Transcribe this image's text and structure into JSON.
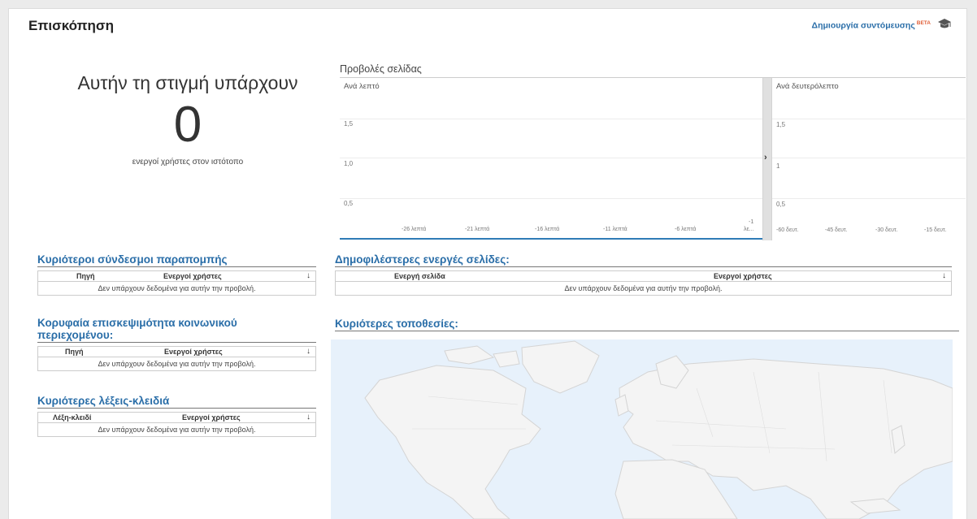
{
  "header": {
    "title": "Επισκόπηση",
    "shortcut_label": "Δημιουργία συντόμευσης",
    "beta_label": "BETA",
    "cap_icon": "graduation-cap-icon"
  },
  "active_users": {
    "headline": "Αυτήν τη στιγμή υπάρχουν",
    "count": "0",
    "subtitle": "ενεργοί χρήστες στον ιστότοπο"
  },
  "pageviews": {
    "title": "Προβολές σελίδας",
    "per_minute": {
      "label": "Ανά λεπτό",
      "y_ticks": [
        "1,5",
        "1,0",
        "0,5"
      ],
      "x_ticks": [
        "-26 λεπτά",
        "-21 λεπτά",
        "-16 λεπτά",
        "-11 λεπτά",
        "-6 λεπτά"
      ],
      "x_last_top": "-1",
      "x_last_bottom": "λε..."
    },
    "per_second": {
      "label": "Ανά δευτερόλεπτο",
      "y_ticks": [
        "1,5",
        "1",
        "0,5"
      ],
      "x_ticks": [
        "-60 δευτ.",
        "-45 δευτ.",
        "-30 δευτ.",
        "-15 δευτ."
      ]
    },
    "divider_arrow": "›"
  },
  "referrals": {
    "title": "Κυριότεροι σύνδεσμοι παραπομπής",
    "col1": "Πηγή",
    "col2": "Ενεργοί χρήστες",
    "empty": "Δεν υπάρχουν δεδομένα για αυτήν την προβολή."
  },
  "social": {
    "title_line1": "Κορυφαία επισκεψιμότητα κοινωνικού",
    "title_line2": "περιεχομένου:",
    "col1": "Πηγή",
    "col2": "Ενεργοί χρήστες",
    "empty": "Δεν υπάρχουν δεδομένα για αυτήν την προβολή."
  },
  "keywords": {
    "title": "Κυριότερες λέξεις-κλειδιά",
    "col1": "Λέξη-κλειδί",
    "col2": "Ενεργοί χρήστες",
    "empty": "Δεν υπάρχουν δεδομένα για αυτήν την προβολή."
  },
  "pages": {
    "title": "Δημοφιλέστερες ενεργές σελίδες:",
    "col1": "Ενεργή σελίδα",
    "col2": "Ενεργοί χρήστες",
    "empty": "Δεν υπάρχουν δεδομένα για αυτήν την προβολή."
  },
  "locations": {
    "title": "Κυριότερες τοποθεσίες:"
  },
  "sort_arrow": "↓",
  "colors": {
    "link": "#2a6ea8",
    "beta": "#e0603a",
    "map_bg": "#e7f1fb",
    "land": "#f3f3f3"
  }
}
